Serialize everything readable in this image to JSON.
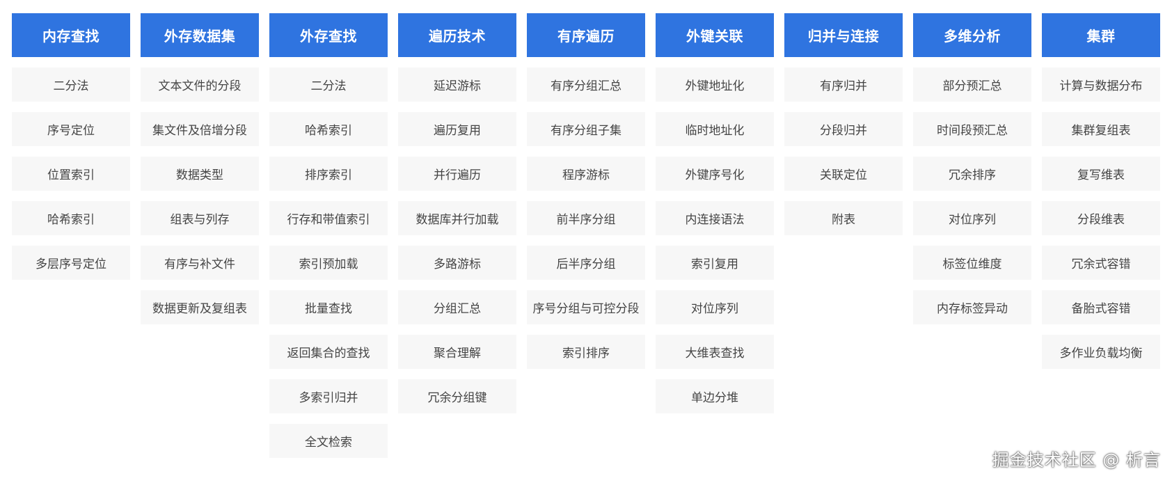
{
  "colors": {
    "header_bg": "#2f74e0",
    "header_text": "#ffffff",
    "item_bg": "#f7f7f7",
    "item_text": "#444444"
  },
  "columns": [
    {
      "id": "memory-lookup",
      "title": "内存查找",
      "items": [
        "二分法",
        "序号定位",
        "位置索引",
        "哈希索引",
        "多层序号定位"
      ]
    },
    {
      "id": "external-datasets",
      "title": "外存数据集",
      "items": [
        "文本文件的分段",
        "集文件及倍增分段",
        "数据类型",
        "组表与列存",
        "有序与补文件",
        "数据更新及复组表"
      ]
    },
    {
      "id": "external-lookup",
      "title": "外存查找",
      "items": [
        "二分法",
        "哈希索引",
        "排序索引",
        "行存和带值索引",
        "索引预加载",
        "批量查找",
        "返回集合的查找",
        "多索引归并",
        "全文检索"
      ]
    },
    {
      "id": "traversal",
      "title": "遍历技术",
      "items": [
        "延迟游标",
        "遍历复用",
        "并行遍历",
        "数据库并行加载",
        "多路游标",
        "分组汇总",
        "聚合理解",
        "冗余分组键"
      ]
    },
    {
      "id": "ordered-traversal",
      "title": "有序遍历",
      "items": [
        "有序分组汇总",
        "有序分组子集",
        "程序游标",
        "前半序分组",
        "后半序分组",
        "序号分组与可控分段",
        "索引排序"
      ]
    },
    {
      "id": "foreign-key",
      "title": "外键关联",
      "items": [
        "外键地址化",
        "临时地址化",
        "外键序号化",
        "内连接语法",
        "索引复用",
        "对位序列",
        "大维表查找",
        "单边分堆"
      ]
    },
    {
      "id": "merge-join",
      "title": "归并与连接",
      "items": [
        "有序归并",
        "分段归并",
        "关联定位",
        "附表"
      ]
    },
    {
      "id": "multidim",
      "title": "多维分析",
      "items": [
        "部分预汇总",
        "时间段预汇总",
        "冗余排序",
        "对位序列",
        "标签位维度",
        "内存标签异动"
      ]
    },
    {
      "id": "cluster",
      "title": "集群",
      "items": [
        "计算与数据分布",
        "集群复组表",
        "复写维表",
        "分段维表",
        "冗余式容错",
        "备胎式容错",
        "多作业负载均衡"
      ]
    }
  ],
  "watermark": "掘金技术社区 @ 析言"
}
